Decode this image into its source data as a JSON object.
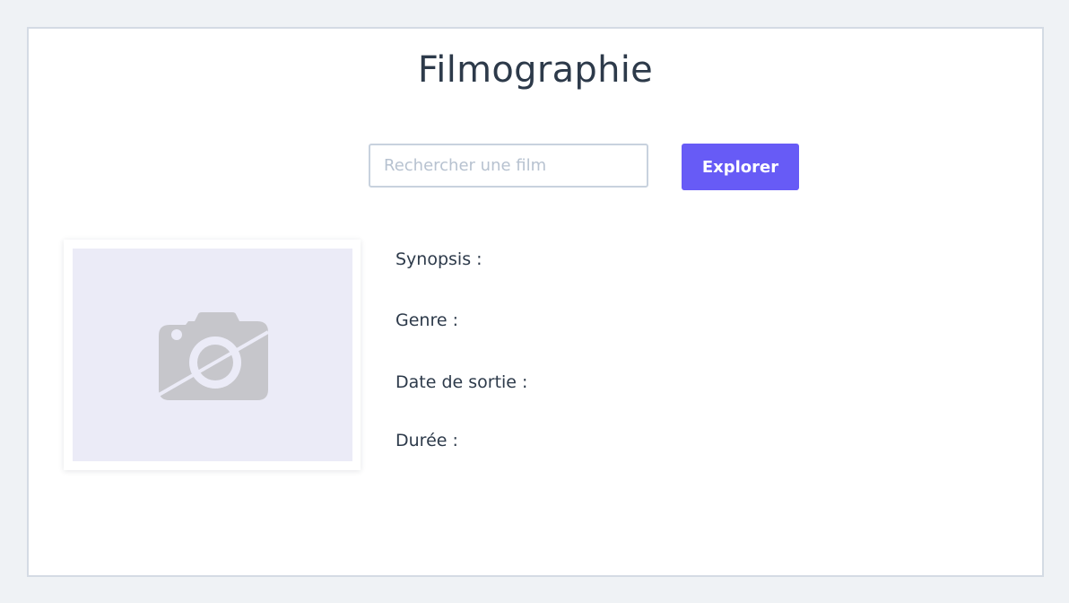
{
  "page": {
    "title": "Filmographie"
  },
  "search": {
    "placeholder": "Rechercher une film",
    "value": "",
    "button_label": "Explorer"
  },
  "poster": {
    "icon": "camera-off-icon"
  },
  "details": {
    "synopsis_label": "Synopsis :",
    "genre_label": "Genre :",
    "release_date_label": "Date de sortie :",
    "duration_label": "Durée :"
  },
  "colors": {
    "accent": "#675bf6",
    "text": "#2d3a4a",
    "background": "#eff2f5",
    "poster_placeholder": "#ebebf7"
  }
}
